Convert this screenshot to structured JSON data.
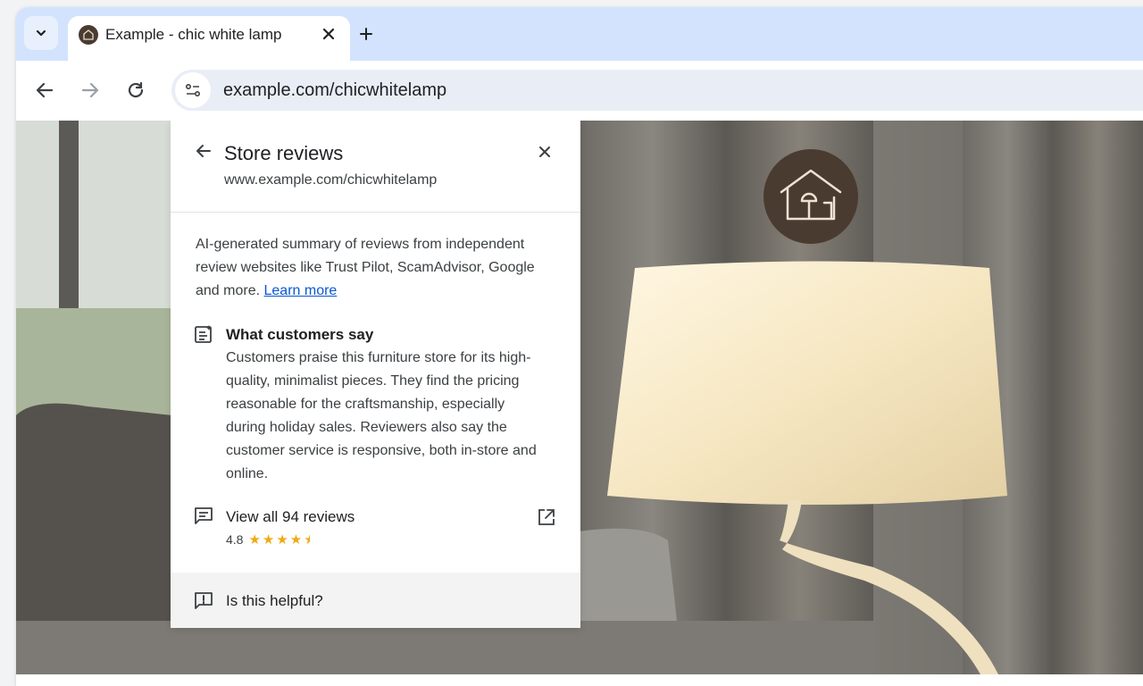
{
  "tab": {
    "title": "Example - chic white lamp"
  },
  "toolbar": {
    "url": "example.com/chicwhitelamp"
  },
  "panel": {
    "title": "Store reviews",
    "url": "www.example.com/chicwhitelamp",
    "summary_text": "AI-generated summary of reviews from independent review websites like Trust Pilot, ScamAdvisor, Google and more.",
    "learn_more": "Learn more",
    "customers_title": "What customers say",
    "customers_body": "Customers praise this furniture store for its high-quality, minimalist pieces. They find the pricing reasonable for the craftsmanship, especially during holiday sales. Reviewers also say the customer service is responsive, both in-store and online.",
    "view_all": "View all 94 reviews",
    "rating": "4.8",
    "rating_value": 4.8,
    "rating_max": 5,
    "helpful": "Is this helpful?"
  },
  "icons": [
    "chevron-down-icon",
    "store-favicon-icon",
    "close-icon",
    "plus-icon",
    "back-arrow-icon",
    "forward-arrow-icon",
    "reload-icon",
    "tune-icon",
    "summary-sparkle-icon",
    "reviews-icon",
    "open-external-icon",
    "feedback-icon",
    "store-logo-icon"
  ],
  "colors": {
    "tabstrip": "#d3e3fd",
    "link": "#0b57d0",
    "star": "#f0a913",
    "logo": "#4a3b30"
  }
}
